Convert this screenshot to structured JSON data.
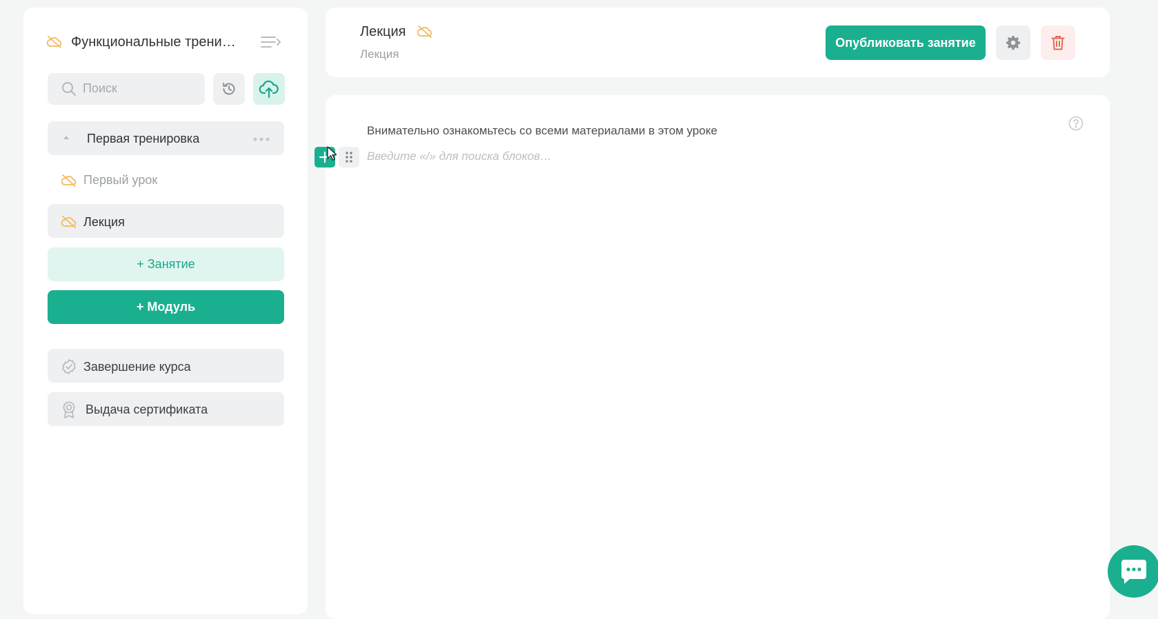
{
  "sidebar": {
    "course_title": "Функциональные трени…",
    "search": {
      "placeholder": "Поиск"
    },
    "module": {
      "title": "Первая тренировка"
    },
    "lessons": [
      {
        "label": "Первый урок"
      },
      {
        "label": "Лекция"
      }
    ],
    "add_lesson_label": "+ Занятие",
    "add_module_label": "+ Модуль",
    "finish_label": "Завершение курса",
    "certificate_label": "Выдача сертификата"
  },
  "header": {
    "title": "Лекция",
    "subtitle": "Лекция",
    "publish_label": "Опубликовать занятие"
  },
  "editor": {
    "instruction": "Внимательно ознакомьтесь со всеми материалами в этом уроке",
    "block_placeholder": "Введите «/» для поиска блоков…"
  },
  "icons": {
    "hidden": "eye-off-cloud-icon",
    "menu": "collapse-menu-icon",
    "search": "search-icon",
    "history": "history-icon",
    "upload": "cloud-upload-icon",
    "more": "more-dots-icon",
    "finish": "badge-check-icon",
    "certificate": "award-icon",
    "settings": "gear-icon",
    "delete": "trash-icon",
    "help": "help-icon",
    "chat": "chat-icon"
  },
  "colors": {
    "accent": "#1aaf8f",
    "accent_light": "#e1f5f0",
    "warning_icon": "#f4b860",
    "danger": "#e26a55",
    "danger_bg": "#fdeeed",
    "panel_bg": "#ffffff",
    "page_bg": "#f4f6f5"
  }
}
